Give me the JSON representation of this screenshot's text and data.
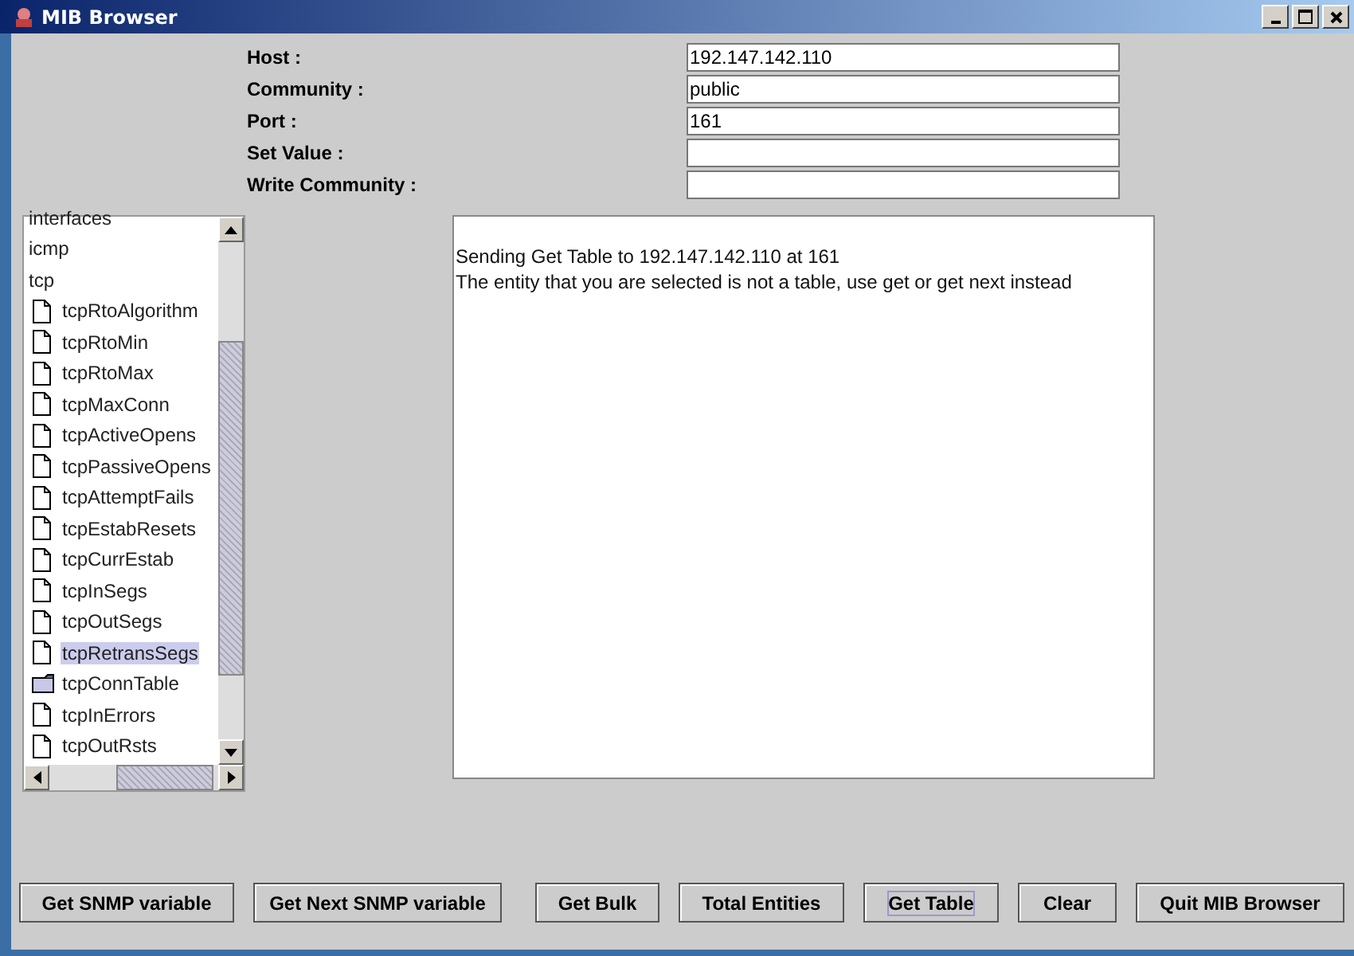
{
  "window": {
    "title": "MIB Browser"
  },
  "form": [
    {
      "label": "Host :",
      "value": "192.147.142.110"
    },
    {
      "label": "Community :",
      "value": "public"
    },
    {
      "label": "Port :",
      "value": "161"
    },
    {
      "label": "Set Value :"
    },
    {
      "label": "Write Community :"
    }
  ],
  "tree": [
    {
      "label": "interfaces",
      "selected": false
    },
    {
      "label": "icmp",
      "selected": false
    },
    {
      "label": "tcp",
      "selected": false,
      "children": [
        {
          "label": "tcpRtoAlgorithm",
          "kind": "leaf",
          "selected": false
        },
        {
          "label": "tcpRtoMin",
          "kind": "leaf",
          "selected": false
        },
        {
          "label": "tcpRtoMax",
          "kind": "leaf",
          "selected": false
        },
        {
          "label": "tcpMaxConn",
          "kind": "leaf",
          "selected": false
        },
        {
          "label": "tcpActiveOpens",
          "kind": "leaf",
          "selected": false
        },
        {
          "label": "tcpPassiveOpens",
          "kind": "leaf",
          "selected": false
        },
        {
          "label": "tcpAttemptFails",
          "kind": "leaf",
          "selected": false
        },
        {
          "label": "tcpEstabResets",
          "kind": "leaf",
          "selected": false
        },
        {
          "label": "tcpCurrEstab",
          "kind": "leaf",
          "selected": false
        },
        {
          "label": "tcpInSegs",
          "kind": "leaf",
          "selected": false
        },
        {
          "label": "tcpOutSegs",
          "kind": "leaf",
          "selected": false
        },
        {
          "label": "tcpRetransSegs",
          "kind": "leaf",
          "selected": true
        },
        {
          "label": "tcpConnTable",
          "kind": "table",
          "selected": false
        },
        {
          "label": "tcpInErrors",
          "kind": "leaf",
          "selected": false
        },
        {
          "label": "tcpOutRsts",
          "kind": "leaf",
          "selected": false
        }
      ]
    }
  ],
  "output": [
    "Sending Get Table to 192.147.142.110 at 161",
    "The entity that you are selected is not a table, use get or get next instead"
  ],
  "buttons": [
    {
      "label": "Get SNMP variable",
      "focused": false
    },
    {
      "label": "Get Next SNMP variable",
      "focused": false
    },
    {
      "label": "Get Bulk",
      "focused": false
    },
    {
      "label": "Total Entities",
      "focused": false
    },
    {
      "label": "Get Table",
      "focused": true
    },
    {
      "label": "Clear",
      "focused": false
    },
    {
      "label": "Quit MIB Browser",
      "focused": false
    }
  ]
}
